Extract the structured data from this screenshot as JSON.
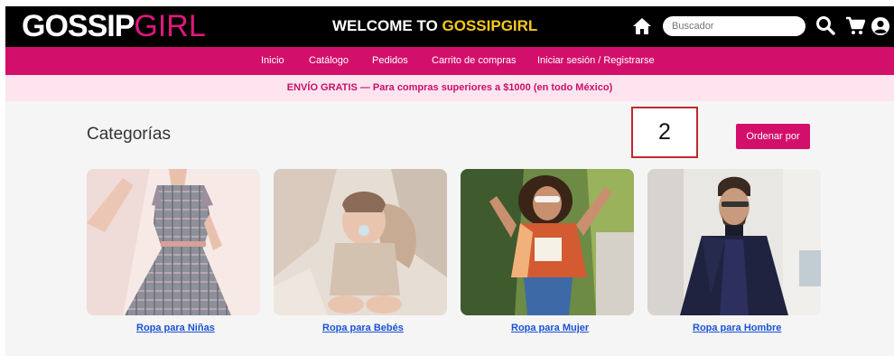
{
  "header": {
    "logo_part1": "GOSSIP",
    "logo_part2": "GIRL",
    "welcome_prefix": "WELCOME TO ",
    "welcome_brand": "GOSSIPGIRL",
    "search_placeholder": "Buscador",
    "icons": [
      "home-icon",
      "search-icon",
      "cart-icon",
      "user-icon"
    ]
  },
  "nav": {
    "items": [
      "Inicio",
      "Catálogo",
      "Pedidos",
      "Carrito de compras",
      "Iniciar sesión / Registrarse"
    ]
  },
  "promo": {
    "text": "ENVÍO GRATIS — Para compras superiores a $1000 (en todo México)"
  },
  "main": {
    "title": "Categorías",
    "annotation": "2",
    "sort_label": "Ordenar por",
    "categories": [
      {
        "label": "Ropa para Niñas"
      },
      {
        "label": "Ropa para Bebés"
      },
      {
        "label": "Ropa para Mujer"
      },
      {
        "label": "Ropa para Hombre"
      }
    ]
  },
  "colors": {
    "brand_pink": "#d2106b",
    "promo_bg": "#fde4ee",
    "link_blue": "#1a52d6",
    "welcome_yellow": "#f7c91e"
  }
}
